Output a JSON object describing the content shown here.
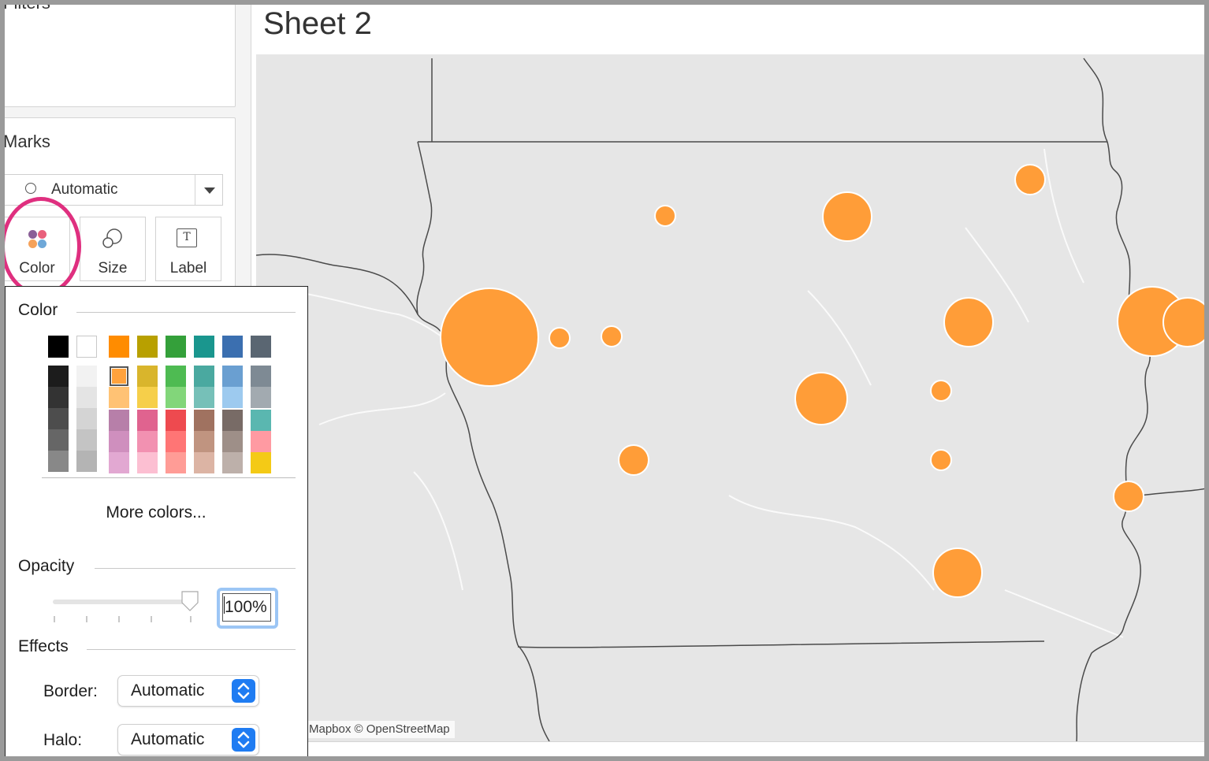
{
  "sidebar": {
    "filters_title": "Filters",
    "marks_title": "Marks",
    "mark_type": "Automatic",
    "cards": [
      {
        "label": "Color",
        "icon": "color-dots-icon"
      },
      {
        "label": "Size",
        "icon": "size-bubbles-icon"
      },
      {
        "label": "Label",
        "icon": "text-label-icon"
      }
    ]
  },
  "sheet": {
    "title": "Sheet 2",
    "attribution": "Mapbox © OpenStreetMap",
    "mark_color": "#ff9d38"
  },
  "map_marks": [
    {
      "id": "city-1",
      "size_rank": 2
    },
    {
      "id": "city-2",
      "size_rank": 4
    },
    {
      "id": "city-3",
      "size_rank": 1
    },
    {
      "id": "city-4",
      "size_rank": 6
    },
    {
      "id": "city-5",
      "size_rank": 4
    },
    {
      "id": "city-6",
      "size_rank": 1
    },
    {
      "id": "city-7",
      "size_rank": 1
    },
    {
      "id": "city-8",
      "size_rank": 3
    },
    {
      "id": "city-9",
      "size_rank": 5
    },
    {
      "id": "city-10",
      "size_rank": 1
    },
    {
      "id": "city-11",
      "size_rank": 2
    },
    {
      "id": "city-12",
      "size_rank": 1
    },
    {
      "id": "city-13",
      "size_rank": 2
    },
    {
      "id": "city-14",
      "size_rank": 4
    },
    {
      "id": "city-15",
      "size_rank": 4
    }
  ],
  "color_popup": {
    "color_title": "Color",
    "more_colors": "More colors...",
    "opacity_title": "Opacity",
    "opacity_value": "100%",
    "opacity_fraction": 1.0,
    "effects_title": "Effects",
    "border_label": "Border:",
    "border_value": "Automatic",
    "halo_label": "Halo:",
    "halo_value": "Automatic",
    "selected_color": "#ffa23d",
    "palette": {
      "top": [
        "#000000",
        "#ffffff",
        "#ff8c00",
        "#b8a000",
        "#34a03a",
        "#1a968e",
        "#3b6fb0",
        "#5a6672"
      ],
      "columns": [
        [
          "#1c1c1c",
          "#333333",
          "#4d4d4d",
          "#666666",
          "#888888"
        ],
        [
          "#f2f2f2",
          "#e4e4e4",
          "#d4d4d4",
          "#c4c4c4",
          "#b4b4b4"
        ],
        [
          "#ffa23d",
          "#ffc274"
        ],
        [
          "#d9b52c",
          "#f6cf4a"
        ],
        [
          "#4ebb52",
          "#82d67a"
        ],
        [
          "#4aa9a0",
          "#76c0b8"
        ],
        [
          "#6a9fd1",
          "#9dcaef"
        ],
        [
          "#7e8a94",
          "#a2aab0"
        ]
      ],
      "lower": [
        [
          "#b77fa9",
          "#cf8fbe",
          "#e2a8d2"
        ],
        [
          "#e0638f",
          "#f291b1",
          "#fcbfd2"
        ],
        [
          "#ee4a4f",
          "#ff7575",
          "#ff9c96"
        ],
        [
          "#a07260",
          "#c09480",
          "#dcb4a4"
        ],
        [
          "#786b66",
          "#9e8f88",
          "#bdb0aa"
        ],
        [
          "#5ab7b0",
          "#ff9aa2",
          "#f4ca16"
        ]
      ]
    }
  }
}
